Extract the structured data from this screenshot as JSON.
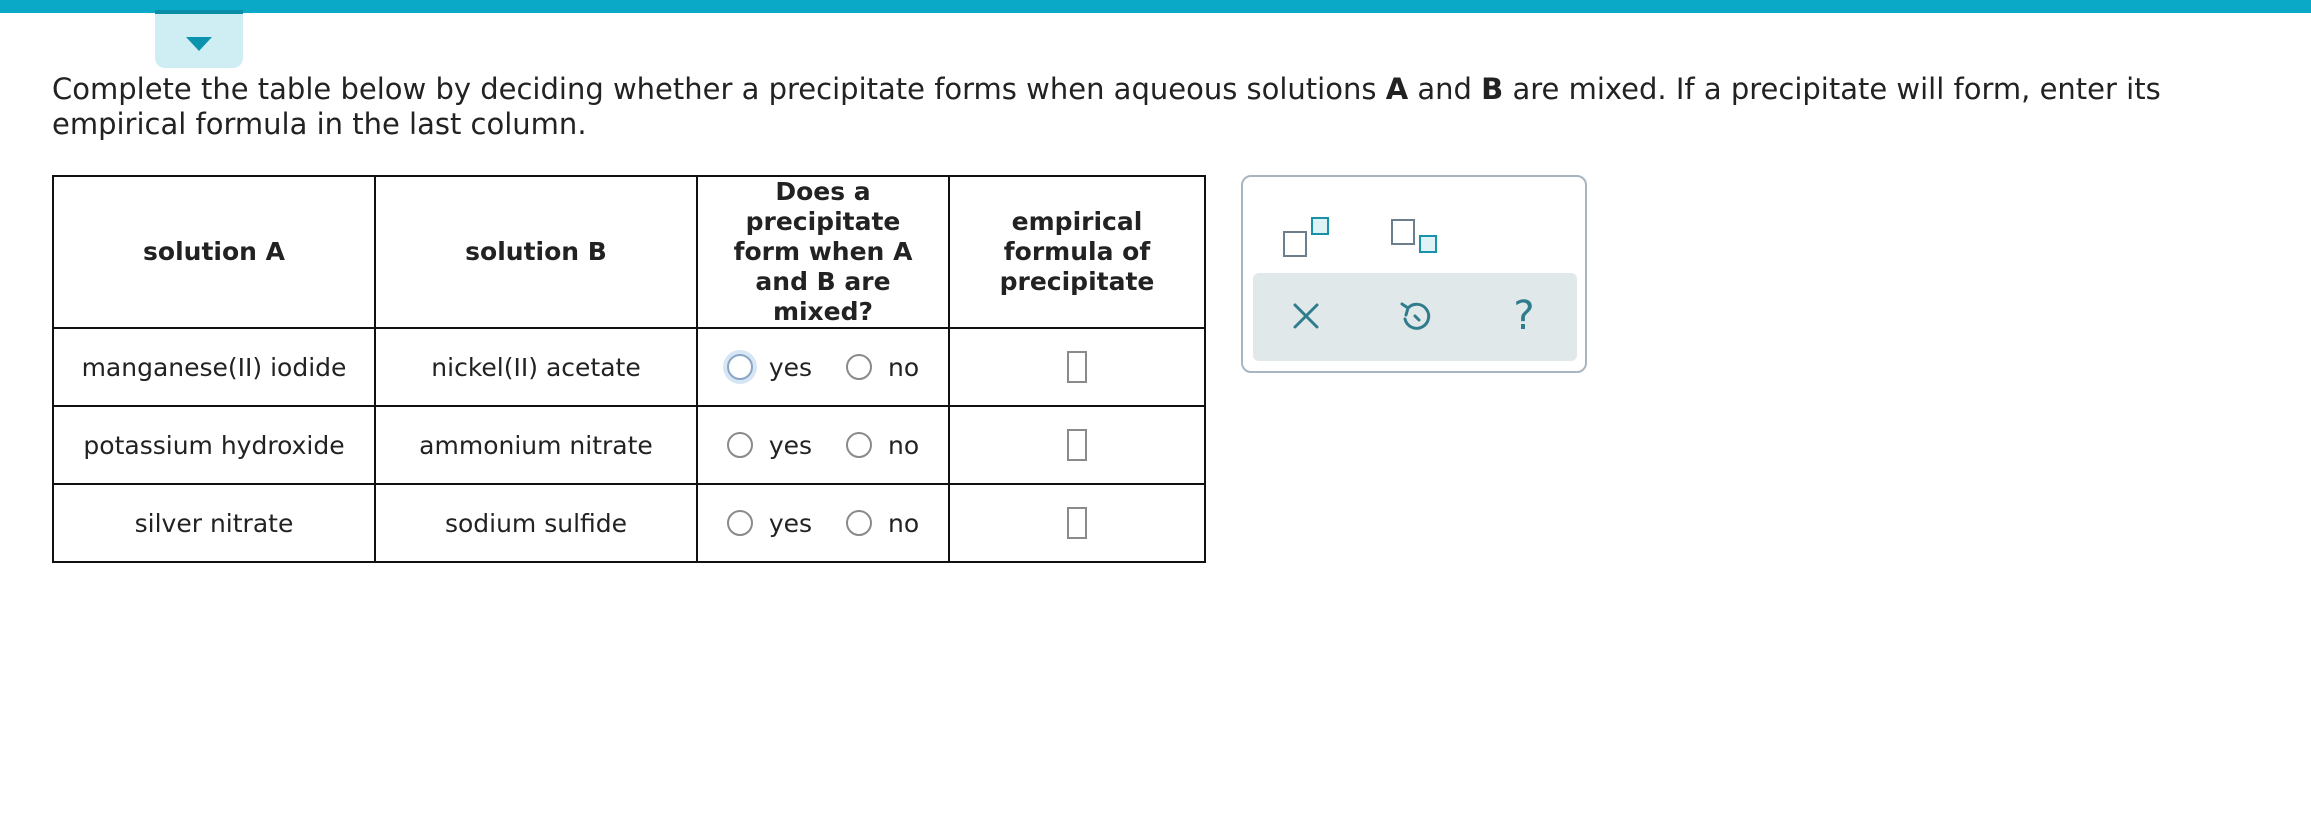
{
  "instructions": {
    "part1": "Complete the table below by deciding whether a precipitate forms when aqueous solutions ",
    "bold_a": "A",
    "part2": " and ",
    "bold_b": "B",
    "part3": " are mixed. If a precipitate will form, enter its empirical formula in the last column."
  },
  "table": {
    "headers": {
      "solution_a": "solution A",
      "solution_b": "solution B",
      "precipitate_q": "Does a precipitate form when A and B are mixed?",
      "formula": "empirical formula of precipitate"
    },
    "rows": [
      {
        "solution_a": "manganese(II) iodide",
        "solution_b": "nickel(II) acetate",
        "yes": "yes",
        "no": "no",
        "formula": ""
      },
      {
        "solution_a": "potassium hydroxide",
        "solution_b": "ammonium nitrate",
        "yes": "yes",
        "no": "no",
        "formula": ""
      },
      {
        "solution_a": "silver nitrate",
        "solution_b": "sodium sulfide",
        "yes": "yes",
        "no": "no",
        "formula": ""
      }
    ]
  },
  "tools": {
    "question_mark": "?"
  },
  "colors": {
    "top_bar": "#0aa9c7",
    "accent": "#1792a8",
    "action_bar": "#e1e8ea"
  },
  "icons": [
    "caret-down-icon",
    "superscript-icon",
    "subscript-icon",
    "close-icon",
    "undo-icon",
    "help-icon"
  ]
}
